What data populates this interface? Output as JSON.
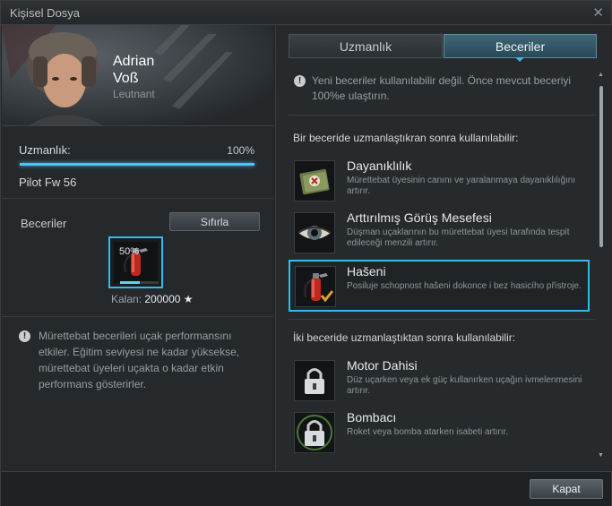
{
  "window": {
    "title": "Kişisel Dosya",
    "close_icon": "✕"
  },
  "pilot": {
    "first_name": "Adrian",
    "last_name": "Voß",
    "rank": "Leutnant"
  },
  "specialization": {
    "label": "Uzmanlık:",
    "percent": "100%",
    "progress": 1.0,
    "aircraft": "Pilot Fw 56"
  },
  "skills_panel": {
    "label": "Beceriler",
    "reset_button": "Sıfırla",
    "slot_percent": "50%",
    "slot_progress": 0.5,
    "remaining_label": "Kalan:",
    "remaining_value": "200000",
    "remaining_icon": "★"
  },
  "info_left": {
    "icon": "!",
    "text": "Mürettebat becerileri uçak performansını etkiler. Eğitim seviyesi ne kadar yüksekse, mürettebat üyeleri uçakta o kadar etkin performans gösterirler."
  },
  "tabs": [
    {
      "label": "Uzmanlık",
      "active": false
    },
    {
      "label": "Beceriler",
      "active": true
    }
  ],
  "notice": {
    "icon": "!",
    "text": "Yeni beceriler kullanılabilir değil. Önce mevcut beceriyi 100%e ulaştırın."
  },
  "section1": {
    "heading": "Bir beceride uzmanlaştıkran sonra kullanılabilir:"
  },
  "section2": {
    "heading": "İki beceride uzmanlaştıktan sonra kullanılabilir:"
  },
  "skills": [
    {
      "name": "Dayanıklılık",
      "desc": "Mürettebat üyesinin canını ve yaralanmaya dayanıklılığını artırır.",
      "icon": "first-aid-kit-icon",
      "selected": false
    },
    {
      "name": "Arttırılmış Görüş Mesefesi",
      "desc": "Düşman uçaklarının bu mürettebat üyesi tarafında tespit edileceği menzili artırır.",
      "icon": "eye-icon",
      "selected": false
    },
    {
      "name": "Hašeni",
      "desc": "Posiluje schopnost hašeni dokonce i bez hasicího přístroje.",
      "icon": "fire-extinguisher-icon",
      "selected": true
    },
    {
      "name": "Motor Dahisi",
      "desc": "Düz uçarken veya ek güç kullanırken uçağın ivmelenmesini artırır.",
      "icon": "lock-icon",
      "selected": false
    },
    {
      "name": "Bombacı",
      "desc": "Roket veya bomba atarken isabeti artırır.",
      "icon": "lock-icon",
      "selected": false
    }
  ],
  "footer": {
    "close_button": "Kapat"
  },
  "colors": {
    "accent": "#37b9ec",
    "panel": "#25292b",
    "text_muted": "#979ea3"
  }
}
